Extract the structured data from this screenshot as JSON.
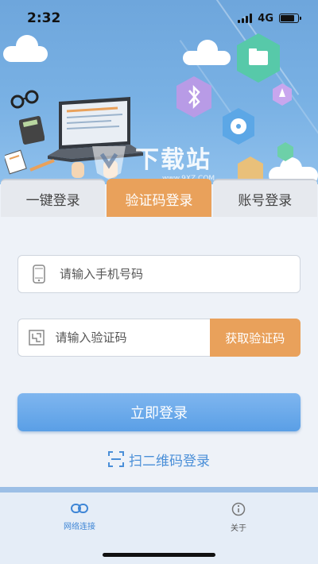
{
  "status_bar": {
    "time": "2:32",
    "network": "4G"
  },
  "watermark": "下载站",
  "watermark_url": "www.9XZ.COM",
  "tabs": [
    {
      "label": "一键登录",
      "active": false
    },
    {
      "label": "验证码登录",
      "active": true
    },
    {
      "label": "账号登录",
      "active": false
    }
  ],
  "form": {
    "phone_placeholder": "请输入手机号码",
    "code_placeholder": "请输入验证码",
    "get_code_label": "获取验证码",
    "login_label": "立即登录",
    "qr_login_label": "扫二维码登录"
  },
  "bottom_nav": {
    "items": [
      {
        "label": "网络连接",
        "icon": "link-icon",
        "active": true
      },
      {
        "label": "关于",
        "icon": "info-icon",
        "active": false
      }
    ]
  },
  "colors": {
    "accent_orange": "#e9a15b",
    "primary_blue": "#5a9fe6",
    "hero_blue": "#79b1e4"
  }
}
